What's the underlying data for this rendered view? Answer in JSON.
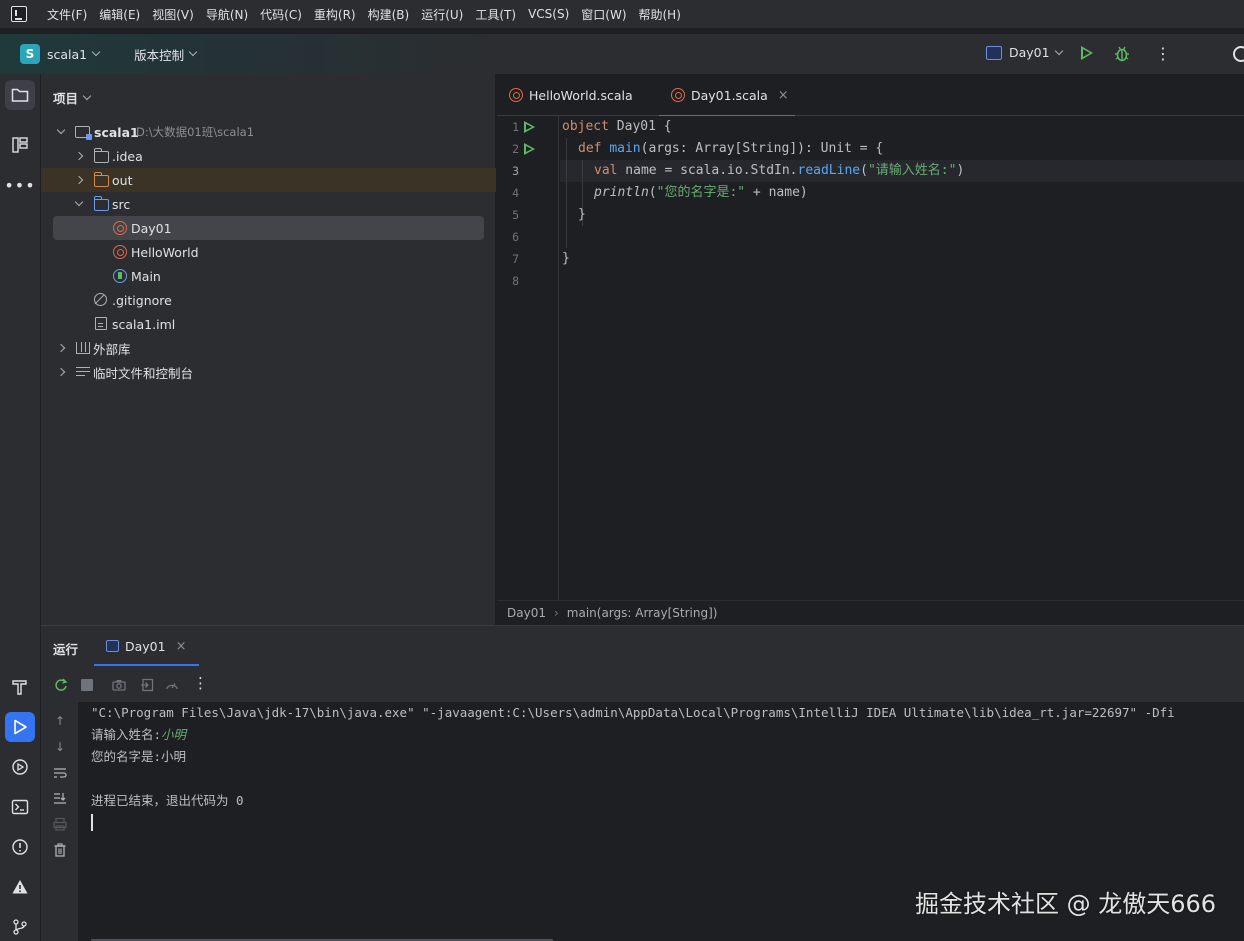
{
  "menu": {
    "items": [
      "文件(F)",
      "编辑(E)",
      "视图(V)",
      "导航(N)",
      "代码(C)",
      "重构(R)",
      "构建(B)",
      "运行(U)",
      "工具(T)",
      "VCS(S)",
      "窗口(W)",
      "帮助(H)"
    ]
  },
  "toolbar": {
    "project_badge": "S",
    "project_name": "scala1",
    "vcs_label": "版本控制",
    "run_config": "Day01",
    "more": "⋮"
  },
  "project_panel": {
    "title": "项目",
    "root_name": "scala1",
    "root_path": "D:\\大数据01班\\scala1",
    "items": {
      "idea": ".idea",
      "out": "out",
      "src": "src",
      "day01": "Day01",
      "helloworld": "HelloWorld",
      "main": "Main",
      "gitignore": ".gitignore",
      "iml": "scala1.iml",
      "external_libs": "外部库",
      "scratches": "临时文件和控制台"
    }
  },
  "editor": {
    "tabs": [
      {
        "label": "HelloWorld.scala",
        "active": false
      },
      {
        "label": "Day01.scala",
        "active": true
      }
    ],
    "close_glyph": "×",
    "line_numbers": [
      "1",
      "2",
      "3",
      "4",
      "5",
      "6",
      "7",
      "8"
    ],
    "current_line": 3,
    "code": {
      "l1_kw": "object",
      "l1_rest": " Day01 {",
      "l2_kw": "def",
      "l2_fn": "main",
      "l2_rest": "(args: Array[String]): Unit = {",
      "l3_kw": "val",
      "l3_mid": " name = scala.io.StdIn.",
      "l3_fn": "readLine",
      "l3_paren_open": "(",
      "l3_str": "\"请输入姓名:\"",
      "l3_paren_close": ")",
      "l4_fn": "println",
      "l4_paren_open": "(",
      "l4_str": "\"您的名字是:\"",
      "l4_rest": " + name)",
      "l5": "}",
      "l7": "}"
    },
    "breadcrumbs": [
      "Day01",
      "main(args: Array[String])"
    ],
    "breadcrumb_sep": "›"
  },
  "run_panel": {
    "title": "运行",
    "tab_label": "Day01",
    "close_glyph": "×",
    "console": {
      "command": "\"C:\\Program Files\\Java\\jdk-17\\bin\\java.exe\" \"-javaagent:C:\\Users\\admin\\AppData\\Local\\Programs\\IntelliJ IDEA Ultimate\\lib\\idea_rt.jar=22697\" -Dfi",
      "prompt": "请输入姓名:",
      "input": "小明",
      "output": "您的名字是:小明",
      "exit": "进程已结束，退出代码为 0"
    }
  },
  "watermark": "掘金技术社区 @ 龙傲天666",
  "colors": {
    "accent": "#3574f0",
    "run_green": "#5fb865",
    "keyword": "#cf8e6d",
    "function": "#56a8f5",
    "string": "#6aab73"
  }
}
